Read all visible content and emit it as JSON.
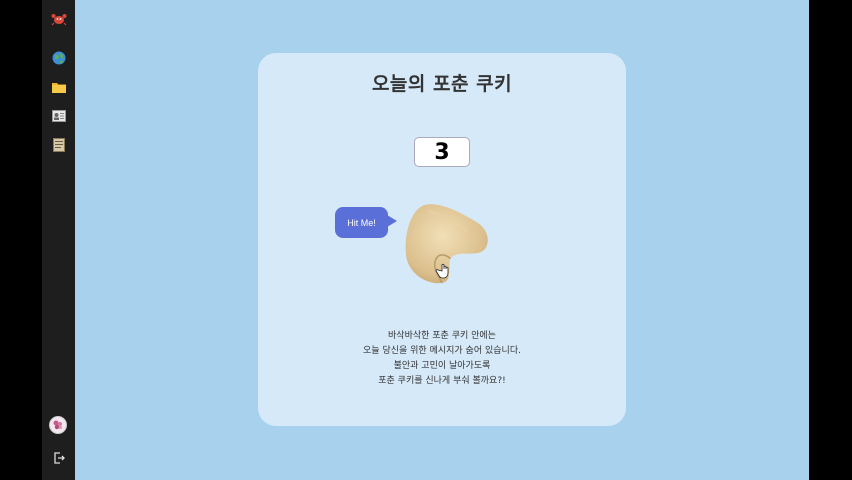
{
  "sidebar": {
    "items": [
      {
        "icon": "crab-icon"
      },
      {
        "icon": "globe-icon"
      },
      {
        "icon": "folder-icon"
      },
      {
        "icon": "contact-card-icon"
      },
      {
        "icon": "notebook-icon"
      }
    ],
    "bottom": [
      {
        "icon": "avatar"
      },
      {
        "icon": "logout-icon"
      }
    ]
  },
  "card": {
    "title": "오늘의 포춘 쿠키",
    "counter": "3",
    "bubble": "Hit Me!",
    "description": [
      "바삭바삭한 포춘 쿠키 안에는",
      "오늘 당신을 위한 메시지가 숨어 있습니다.",
      "불안과 고민이 날아가도록",
      "포춘 쿠키를 신나게 부숴 볼까요?!"
    ]
  },
  "colors": {
    "background": "#a8d1ee",
    "card": "#d6e9f8",
    "bubble": "#5b6fd9",
    "sidebar": "#1e1e1e"
  }
}
